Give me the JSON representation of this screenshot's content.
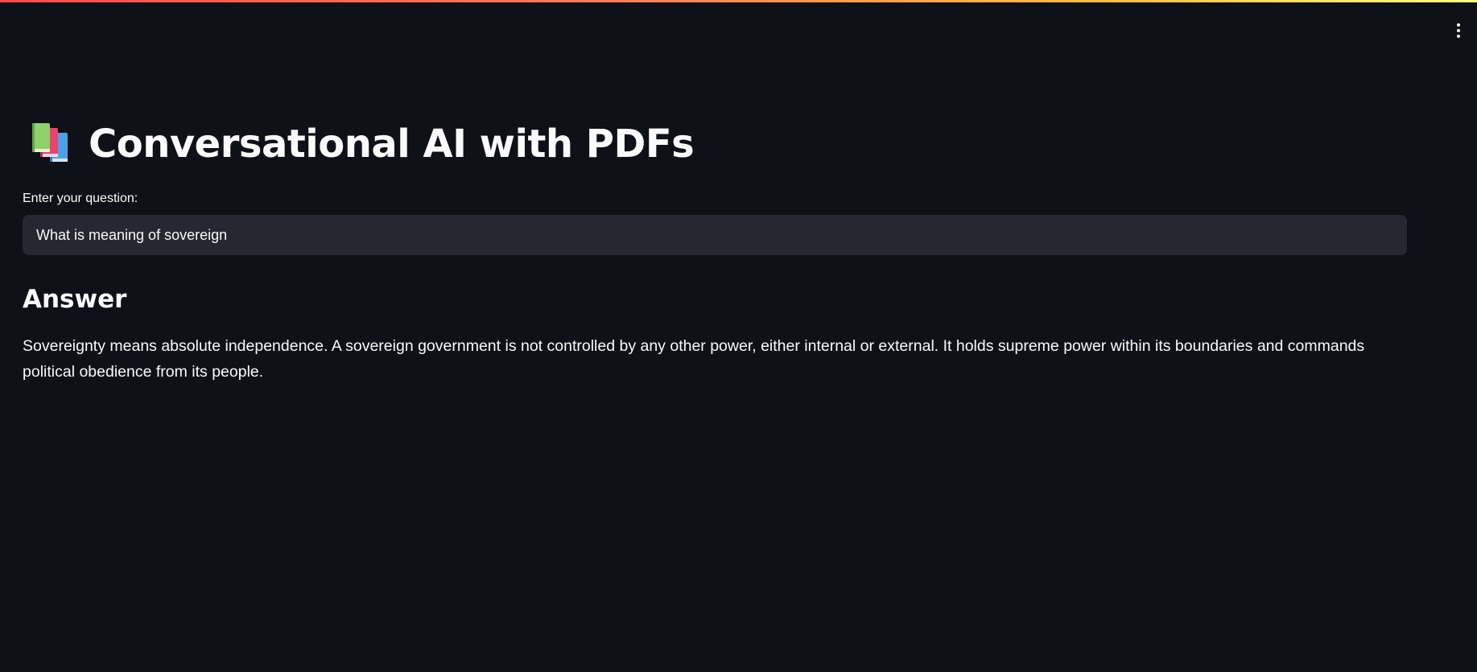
{
  "header": {
    "accent_gradient": [
      "#ff4b4b",
      "#ffbd45",
      "#fffd80"
    ],
    "menu_icon": "vertical-ellipsis-icon"
  },
  "main": {
    "title_icon": "books-icon",
    "title": "Conversational AI with PDFs",
    "question_label": "Enter your question:",
    "question_value": "What is meaning of sovereign",
    "answer_heading": "Answer",
    "answer_text": "Sovereignty means absolute independence. A sovereign government is not controlled by any other power, either internal or external. It holds supreme power within its boundaries and commands political obedience from its people."
  },
  "colors": {
    "background": "#0e1117",
    "input_background": "#262730",
    "text": "#fafafa"
  }
}
